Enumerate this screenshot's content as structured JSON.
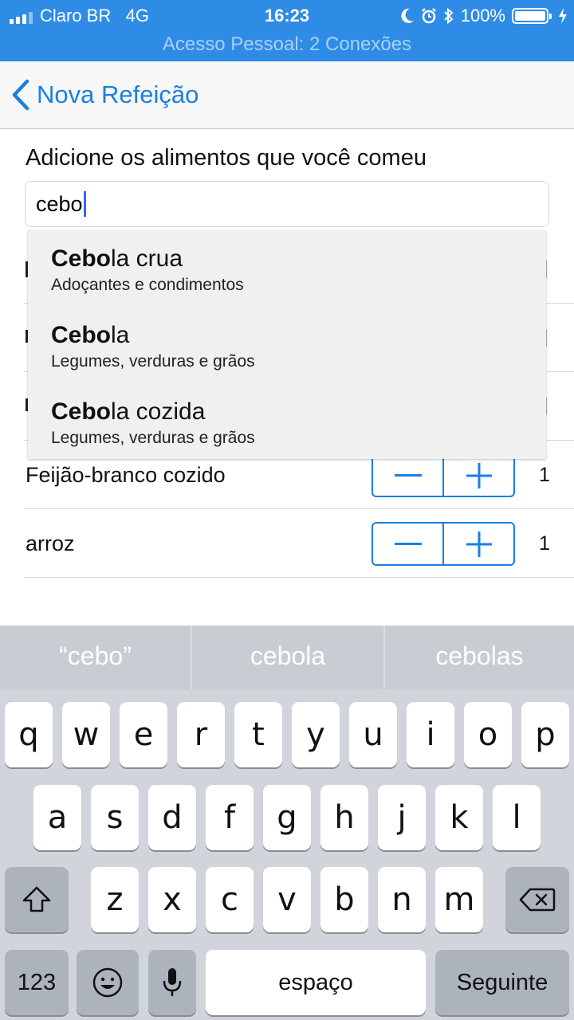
{
  "status_bar": {
    "carrier": "Claro BR",
    "network": "4G",
    "time": "16:23",
    "battery_percent": "100%",
    "battery_level": 1.0,
    "hotspot": "Acesso Pessoal: 2 Conexões"
  },
  "nav": {
    "back_label": "Nova Refeição"
  },
  "form": {
    "prompt": "Adicione os alimentos que você comeu",
    "search_value": "cebo"
  },
  "suggestions": [
    {
      "match": "Cebo",
      "rest": "la crua",
      "category": "Adoçantes e condimentos"
    },
    {
      "match": "Cebo",
      "rest": "la",
      "category": "Legumes, verduras e grãos"
    },
    {
      "match": "Cebo",
      "rest": "la cozida",
      "category": "Legumes, verduras e grãos"
    }
  ],
  "foods": [
    {
      "name": "Feijão-branco cozido",
      "quantity": "1"
    },
    {
      "name": "arroz",
      "quantity": "1"
    }
  ],
  "keyboard": {
    "predictions": [
      "“cebo”",
      "cebola",
      "cebolas"
    ],
    "row1": [
      "q",
      "w",
      "e",
      "r",
      "t",
      "y",
      "u",
      "i",
      "o",
      "p"
    ],
    "row2": [
      "a",
      "s",
      "d",
      "f",
      "g",
      "h",
      "j",
      "k",
      "l"
    ],
    "row3": [
      "z",
      "x",
      "c",
      "v",
      "b",
      "n",
      "m"
    ],
    "numbers_label": "123",
    "space_label": "espaço",
    "next_label": "Seguinte"
  },
  "colors": {
    "accent": "#1a7fe3",
    "status_bar": "#2f8ce6",
    "keyboard_bg": "#d1d4da"
  }
}
